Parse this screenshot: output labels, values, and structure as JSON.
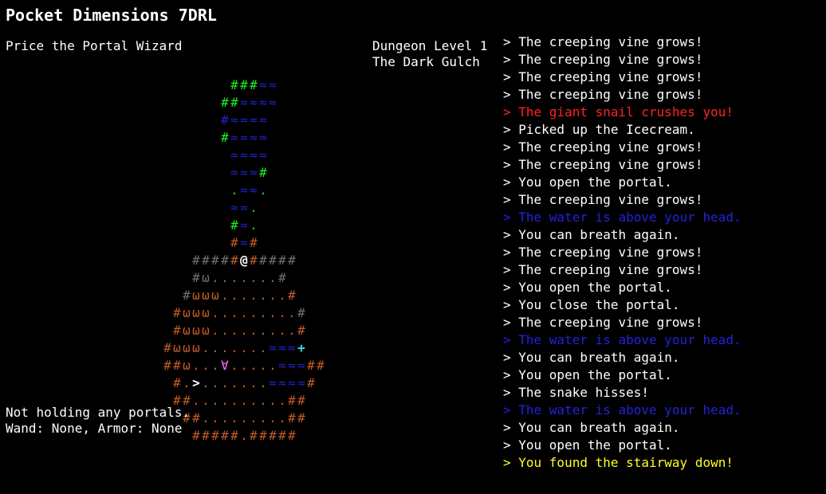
{
  "game": {
    "title": "Pocket Dimensions 7DRL"
  },
  "player": {
    "name": "Price the Portal Wizard",
    "portal_status": "Not holding any portals.",
    "equipment": "Wand: None, Armor: None"
  },
  "location": {
    "dungeon_level": "Dungeon Level 1",
    "level_name": "The Dark Gulch"
  },
  "palette": {
    "W": "#ffffff",
    "R": "#c05a28",
    "G": "#707070",
    "V": "#22ee22",
    "B": "#2222cc",
    "C": "#33ddee",
    "P": "#ff66ff",
    "g": "#22cc22"
  },
  "map": {
    "origin_col": 17,
    "rows": [
      {
        "text": "       ###≈≈",
        "colors": "       VVVBB"
      },
      {
        "text": "      ##≈≈≈≈",
        "colors": "      VVBBBB"
      },
      {
        "text": "      #≈≈≈≈",
        "colors": "      BBBBB"
      },
      {
        "text": "      #≈≈≈≈",
        "colors": "      VBBBB"
      },
      {
        "text": "       ≈≈≈≈",
        "colors": "       BBBB"
      },
      {
        "text": "       ≈≈≈#",
        "colors": "       BBBV"
      },
      {
        "text": "       .≈≈.",
        "colors": "       gBBg"
      },
      {
        "text": "       ≈≈.",
        "colors": "       BBg"
      },
      {
        "text": "       #≈.",
        "colors": "       VBg"
      },
      {
        "text": "       #≈#",
        "colors": "       RBR"
      },
      {
        "text": "   #####@#####",
        "colors": "   GGGGRWRGGGGG"
      },
      {
        "text": "   #ω.......#",
        "colors": "   GGGGGGGGGGG"
      },
      {
        "text": "  #ωωω.......#",
        "colors": "  GRRRRRRRRRRR"
      },
      {
        "text": " #ωωω.........#",
        "colors": " RRRRRRRRRRRRRG"
      },
      {
        "text": " #ωωω.........#",
        "colors": " RRRRRRRRRRRRRR"
      },
      {
        "text": "#ωωω.......≈≈≈+",
        "colors": "RRRRRRRRRRRBBBC"
      },
      {
        "text": "##ω...∀.....≈≈≈##",
        "colors": "RRRRRRPRRRRRBBBRR"
      },
      {
        "text": " #.>.......≈≈≈≈#",
        "colors": " RRWRRRRRRRBBBBR"
      },
      {
        "text": " ##..........##",
        "colors": " RRRRRRRRRRRRRR"
      },
      {
        "text": "  ##.........##",
        "colors": "  RRRRRRRRRRRRR"
      },
      {
        "text": "   #####.#####",
        "colors": "   RRRRRRRRRRR"
      }
    ]
  },
  "message_log": [
    {
      "text": "> The creeping vine grows!",
      "color": "#ffffff"
    },
    {
      "text": "> The creeping vine grows!",
      "color": "#ffffff"
    },
    {
      "text": "> The creeping vine grows!",
      "color": "#ffffff"
    },
    {
      "text": "> The creeping vine grows!",
      "color": "#ffffff"
    },
    {
      "text": "> The giant snail crushes you!",
      "color": "#ff2222"
    },
    {
      "text": "> Picked up the Icecream.",
      "color": "#ffffff"
    },
    {
      "text": "> The creeping vine grows!",
      "color": "#ffffff"
    },
    {
      "text": "> The creeping vine grows!",
      "color": "#ffffff"
    },
    {
      "text": "> You open the portal.",
      "color": "#ffffff"
    },
    {
      "text": "> The creeping vine grows!",
      "color": "#ffffff"
    },
    {
      "text": "> The water is above your head.",
      "color": "#2222dd"
    },
    {
      "text": "> You can breath again.",
      "color": "#ffffff"
    },
    {
      "text": "> The creeping vine grows!",
      "color": "#ffffff"
    },
    {
      "text": "> The creeping vine grows!",
      "color": "#ffffff"
    },
    {
      "text": "> You open the portal.",
      "color": "#ffffff"
    },
    {
      "text": "> You close the portal.",
      "color": "#ffffff"
    },
    {
      "text": "> The creeping vine grows!",
      "color": "#ffffff"
    },
    {
      "text": "> The water is above your head.",
      "color": "#2222dd"
    },
    {
      "text": "> You can breath again.",
      "color": "#ffffff"
    },
    {
      "text": "> You open the portal.",
      "color": "#ffffff"
    },
    {
      "text": "> The snake hisses!",
      "color": "#ffffff"
    },
    {
      "text": "> The water is above your head.",
      "color": "#2222dd"
    },
    {
      "text": "> You can breath again.",
      "color": "#ffffff"
    },
    {
      "text": "> You open the portal.",
      "color": "#ffffff"
    },
    {
      "text": "> You found the stairway down!",
      "color": "#ffff22"
    }
  ]
}
